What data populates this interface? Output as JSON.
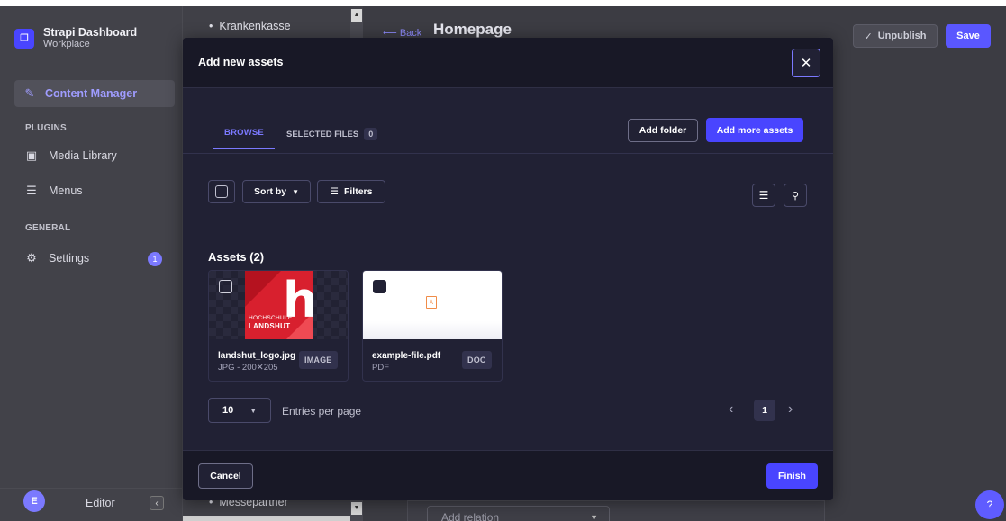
{
  "sidebar": {
    "brand_title": "Strapi Dashboard",
    "brand_subtitle": "Workplace",
    "content_manager": "Content Manager",
    "plugins_section": "PLUGINS",
    "media_library": "Media Library",
    "menus": "Menus",
    "general_section": "GENERAL",
    "settings": "Settings",
    "settings_badge": "1",
    "avatar_initial": "E",
    "user_role": "Editor"
  },
  "background": {
    "list_item_top": "Krankenkasse",
    "list_item_bottom": "Messepartner",
    "back_link": "Back",
    "page_title": "Homepage",
    "unpublish": "Unpublish",
    "save": "Save",
    "add_relation_placeholder": "Add relation",
    "help": "?"
  },
  "modal": {
    "title": "Add new assets",
    "tabs": {
      "browse": "BROWSE",
      "selected_files": "SELECTED FILES",
      "selected_count": "0"
    },
    "add_folder": "Add folder",
    "add_more_assets": "Add more assets",
    "sort_by": "Sort by",
    "filters": "Filters",
    "assets_heading": "Assets (2)",
    "assets": [
      {
        "name": "landshut_logo.jpg",
        "meta": "JPG - 200✕205",
        "type": "IMAGE"
      },
      {
        "name": "example-file.pdf",
        "meta": "PDF",
        "type": "DOC"
      }
    ],
    "logo": {
      "line1": "HOCHSCHULE",
      "line2": "LANDSHUT"
    },
    "entries_per_page_value": "10",
    "entries_per_page_label": "Entries per page",
    "current_page": "1",
    "cancel": "Cancel",
    "finish": "Finish"
  },
  "colors": {
    "primary": "#4945ff",
    "modal_bg": "#212134",
    "modal_header_bg": "#181826",
    "sidebar_bg": "#424249"
  }
}
